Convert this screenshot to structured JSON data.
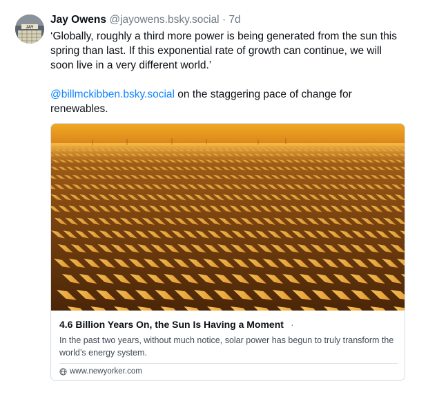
{
  "post": {
    "author": {
      "display_name": "Jay Owens",
      "handle": "@jayowens.bsky.social",
      "avatar_text": "JAY"
    },
    "separator": "·",
    "timestamp": "7d",
    "text_quote": "‘Globally, roughly a third more power is being generated from the sun this spring than last. If this exponential rate of growth can continue, we will soon live in a very different world.’",
    "mention": "@billmckibben.bsky.social",
    "text_rest": " on the staggering pace of change for renewables."
  },
  "link_card": {
    "title": "4.6 Billion Years On, the Sun Is Having a Moment",
    "title_suffix": "·",
    "description": "In the past two years, without much notice, solar power has begun to truly transform the world’s energy system.",
    "domain": "www.newyorker.com",
    "domain_icon": "globe-icon",
    "image": "solar-farm-at-sunset"
  },
  "colors": {
    "link": "#1083fe",
    "text": "#0b0f14",
    "muted": "#6f7a86",
    "border": "#d4dbe2"
  }
}
